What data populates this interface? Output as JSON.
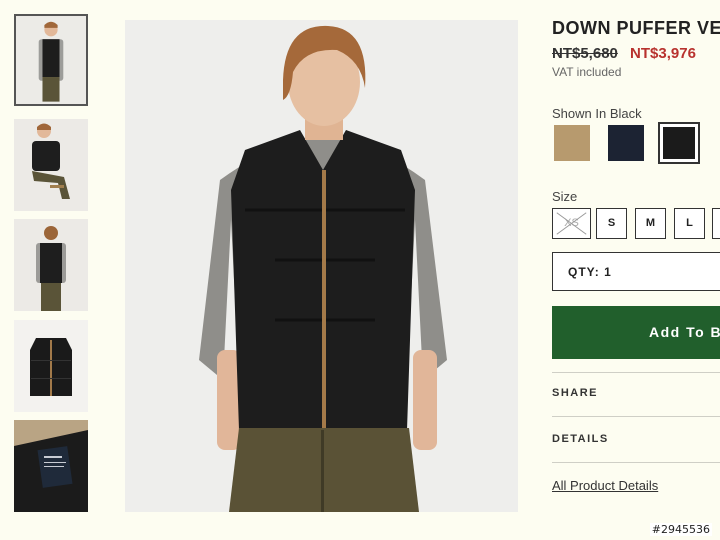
{
  "product": {
    "title": "DOWN PUFFER VEST",
    "old_price": "NT$5,680",
    "new_price": "NT$3,976",
    "vat": "VAT included"
  },
  "color": {
    "label": "Shown In Black",
    "swatches": [
      {
        "name": "tan",
        "hex": "#b79a6e"
      },
      {
        "name": "navy",
        "hex": "#1c2333"
      },
      {
        "name": "black",
        "hex": "#1b1b1b",
        "selected": true
      }
    ]
  },
  "size": {
    "label": "Size",
    "options": [
      {
        "label": "XS",
        "available": false
      },
      {
        "label": "S",
        "available": true
      },
      {
        "label": "M",
        "available": true
      },
      {
        "label": "L",
        "available": true
      }
    ]
  },
  "qty": {
    "text": "QTY:  1"
  },
  "add_to_bag": {
    "label": "Add To B"
  },
  "accordion": {
    "share": "SHARE",
    "details": "DETAILS"
  },
  "all_details_link": "All Product Details",
  "watermark": "#2945536",
  "colors": {
    "accent_green": "#215f2c",
    "sale_red": "#b8322e",
    "page_bg": "#fdfdf1"
  }
}
